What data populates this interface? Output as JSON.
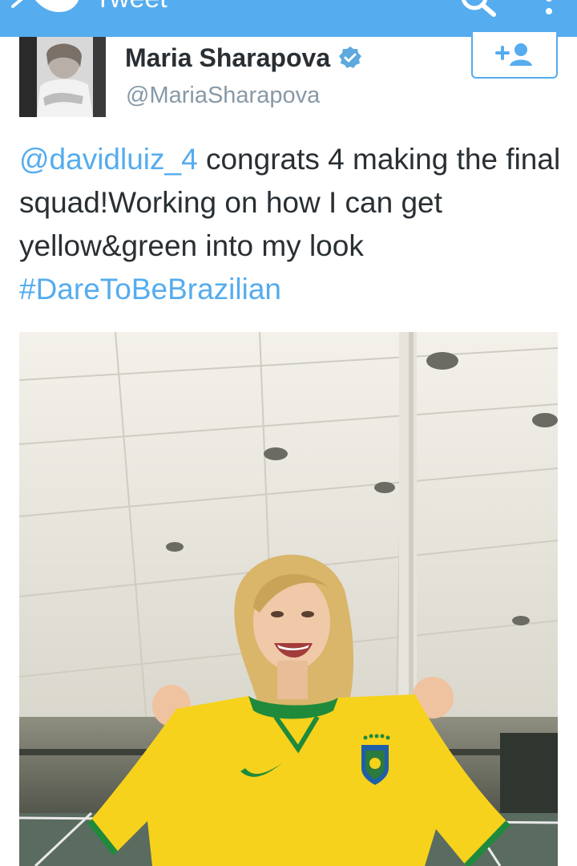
{
  "header": {
    "title": "Tweet",
    "bar_color": "#55acee",
    "icons": [
      "back-arrow-icon",
      "twitter-bird-icon",
      "search-icon",
      "overflow-menu-icon"
    ]
  },
  "author": {
    "name": "Maria Sharapova",
    "handle": "@MariaSharapova",
    "verified": true,
    "follow_icon": "add-user-icon"
  },
  "tweet": {
    "mention": "@davidluiz_4",
    "body": " congrats 4 making the final squad!Working on how I can get yellow&green into my look ",
    "hashtag": "#DareToBeBrazilian",
    "text_color": "#292f33",
    "link_color": "#55acee"
  },
  "media": {
    "kind": "photo",
    "shirt_color": "#f6d21c",
    "trim_color": "#1f8a3c"
  }
}
